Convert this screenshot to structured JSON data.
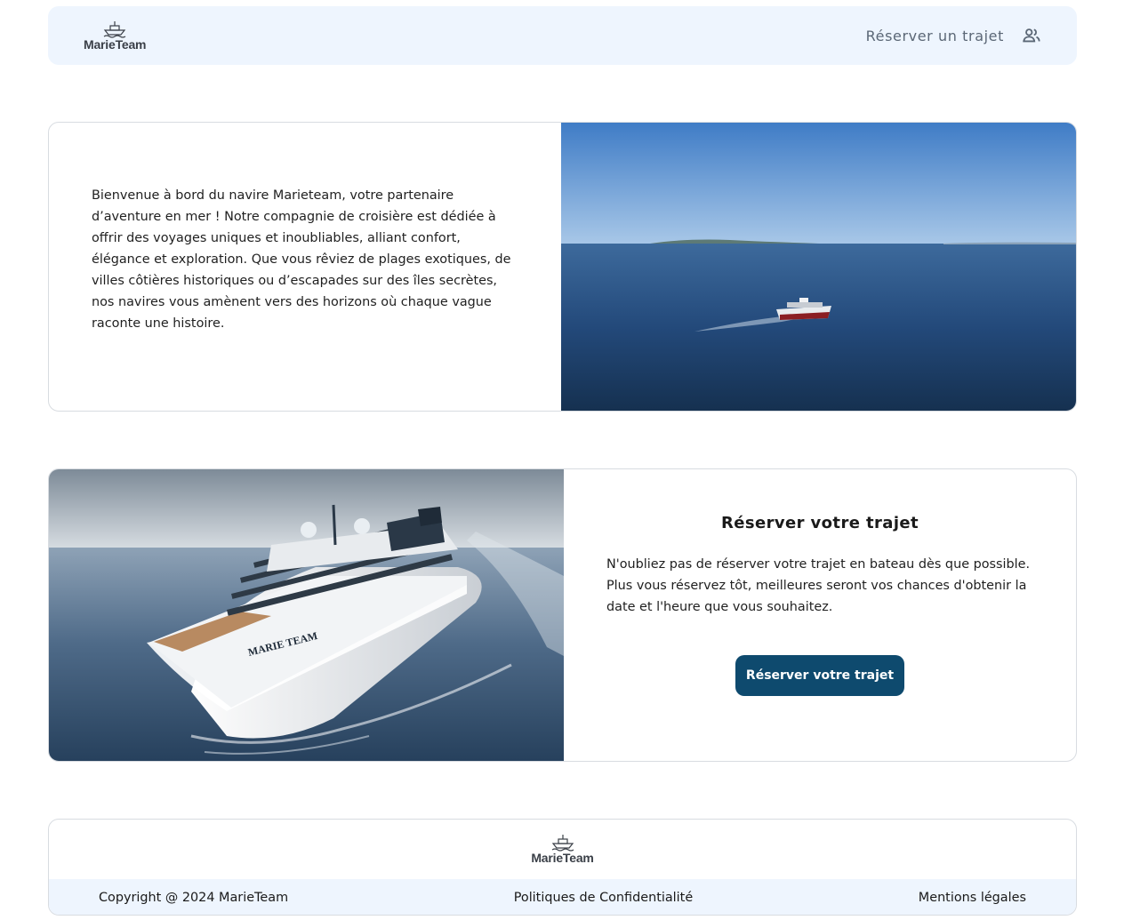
{
  "header": {
    "logo_text": "MarieTeam",
    "nav_link": "Réserver un trajet",
    "user_icon": "user-group-icon"
  },
  "intro": {
    "text": "Bienvenue à bord du navire Marieteam, votre partenaire d’aventure en mer ! Notre compagnie de croisière est dédiée à offrir des voyages uniques et inoubliables, alliant confort, élégance et exploration. Que vous rêviez de plages exotiques, de villes côtières historiques ou d’escapades sur des îles secrètes, nos navires vous amènent vers des horizons où chaque vague raconte une histoire."
  },
  "reserve": {
    "title": "Réserver votre trajet",
    "text": "N'oubliez pas de réserver votre trajet en bateau dès que possible. Plus vous réservez tôt, meilleures seront vos chances d'obtenir la date et l'heure que vous souhaitez.",
    "button_label": "Réserver votre trajet",
    "ship_name": "MARIE TEAM"
  },
  "footer": {
    "logo_text": "MarieTeam",
    "copyright": "Copyright @ 2024 MarieTeam",
    "privacy": "Politiques de Confidentialité",
    "legal": "Mentions légales"
  },
  "colors": {
    "nav_bg": "#eef5fe",
    "button_bg": "#0e4a6e",
    "border": "#d8dce1"
  }
}
